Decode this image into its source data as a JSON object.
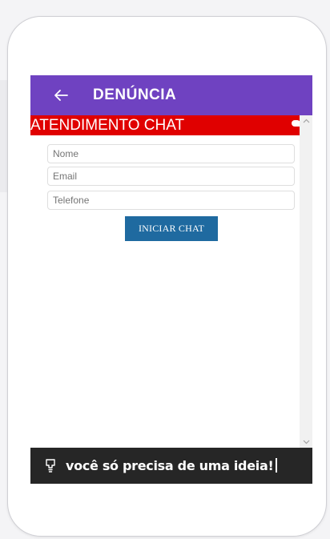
{
  "app_bar": {
    "title": "DENÚNCIA",
    "color": "#6f42c1",
    "back_icon": "arrow-left-icon"
  },
  "chat": {
    "header": "ATENDIMENTO CHAT",
    "header_color": "#e00000",
    "fields": {
      "name_placeholder": "Nome",
      "email_placeholder": "Email",
      "phone_placeholder": "Telefone"
    },
    "start_button": "INICIAR CHAT",
    "button_color": "#1f6aa0"
  },
  "banner": {
    "text": "você só precisa de uma ideia!",
    "icon": "lightbulb-icon",
    "color": "#262626"
  }
}
